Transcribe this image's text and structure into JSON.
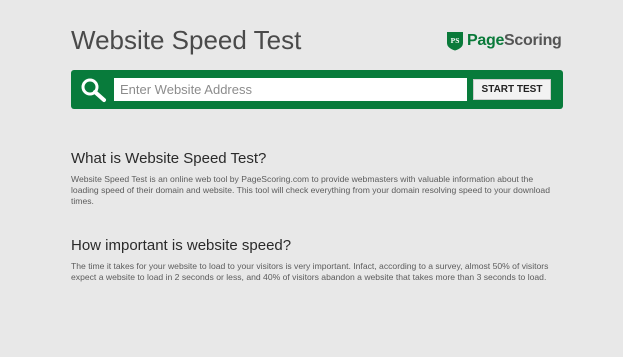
{
  "header": {
    "title": "Website Speed Test",
    "logo": {
      "badge_text": "PS",
      "name_part1": "Page",
      "name_part2": "Scoring"
    }
  },
  "search": {
    "placeholder": "Enter Website Address",
    "value": "",
    "button_label": "START TEST",
    "icon": "search-icon"
  },
  "sections": [
    {
      "heading": "What is Website Speed Test?",
      "body": "Website Speed Test is an online web tool by PageScoring.com to provide webmasters with valuable information about the loading speed of their domain and website. This tool will check everything from your domain resolving speed to your download times."
    },
    {
      "heading": "How important is website speed?",
      "body": "The time it takes for your website to load to your visitors is very important. Infact, according to a survey, almost 50% of visitors expect a website to load in 2 seconds or less, and 40% of visitors abandon a website that takes more than 3 seconds to load."
    }
  ],
  "colors": {
    "brand_green": "#087b3b",
    "background": "#e8e8e8",
    "title_text": "#4a4a4a"
  }
}
